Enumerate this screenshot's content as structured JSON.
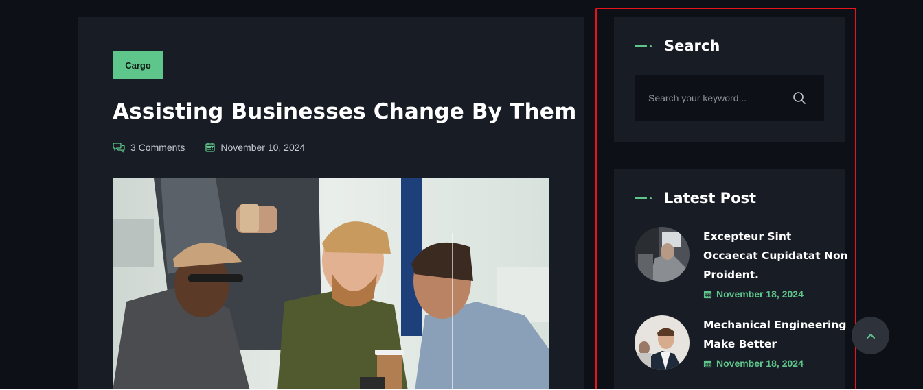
{
  "article": {
    "category": "Cargo",
    "title": "Assisting Businesses Change By Them",
    "comments": "3 Comments",
    "date": "November 10, 2024"
  },
  "sidebar": {
    "search": {
      "title": "Search",
      "placeholder": "Search your keyword..."
    },
    "latest": {
      "title": "Latest Post",
      "posts": [
        {
          "title": "Excepteur Sint Occaecat Cupidatat Non Proident.",
          "date": "November 18, 2024"
        },
        {
          "title": "Mechanical Engineering Make Better",
          "date": "November 18, 2024"
        }
      ]
    }
  },
  "colors": {
    "accent": "#5ec58b",
    "background": "#0d1016",
    "card": "#181c25",
    "highlight_outline": "#e8141b"
  },
  "icons": {
    "comments": "comments-icon",
    "calendar": "calendar-icon",
    "search": "search-icon",
    "scroll_top": "chevron-up-icon"
  }
}
